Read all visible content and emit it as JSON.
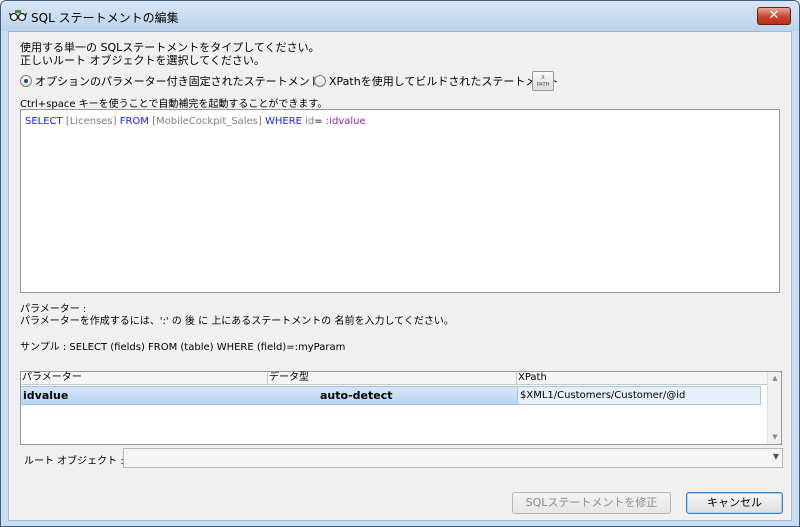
{
  "window": {
    "title": "SQL ステートメントの編集",
    "close_glyph": "✕"
  },
  "description": {
    "line1": "使用する単一の SQLステートメントをタイプしてください。",
    "line2": "正しいルート オブジェクトを選択してください。"
  },
  "options": {
    "fixed_label": "オプションのパラメーター付き固定されたステートメント",
    "fixed_checked": true,
    "xpath_label": "XPathを使用してビルドされたステートメント",
    "xpath_checked": false,
    "xpath_button_text": "X\nPATH"
  },
  "hint": "Ctrl+space キーを使うことで自動補完を起動することができます。",
  "editor": {
    "tokens": [
      {
        "text": "SELECT ",
        "kind": "kw"
      },
      {
        "text": "[Licenses]",
        "kind": "ident"
      },
      {
        "text": " FROM ",
        "kind": "kw"
      },
      {
        "text": "[MobileCockpit_Sales]",
        "kind": "ident"
      },
      {
        "text": " WHERE ",
        "kind": "kw"
      },
      {
        "text": "id",
        "kind": "ident"
      },
      {
        "text": "= ",
        "kind": "plain"
      },
      {
        "text": ":idvalue",
        "kind": "param"
      }
    ]
  },
  "parameters_info": {
    "heading": "パラメーター :",
    "line": "パラメーターを作成するには、':' の 後 に 上にあるステートメントの 名前を入力してください。",
    "sample": "サンプル : SELECT (fields) FROM (table) WHERE (field)=:myParam"
  },
  "grid": {
    "columns": [
      "パラメーター",
      "データ型",
      "XPath"
    ],
    "rows": [
      {
        "name": "idvalue",
        "type": "auto-detect",
        "xpath": "$XML1/Customers/Customer/@id"
      }
    ]
  },
  "root_object": {
    "label": "ルート オブジェクト :",
    "value": ""
  },
  "buttons": {
    "modify": "SQLステートメントを修正",
    "cancel": "キャンセル"
  }
}
